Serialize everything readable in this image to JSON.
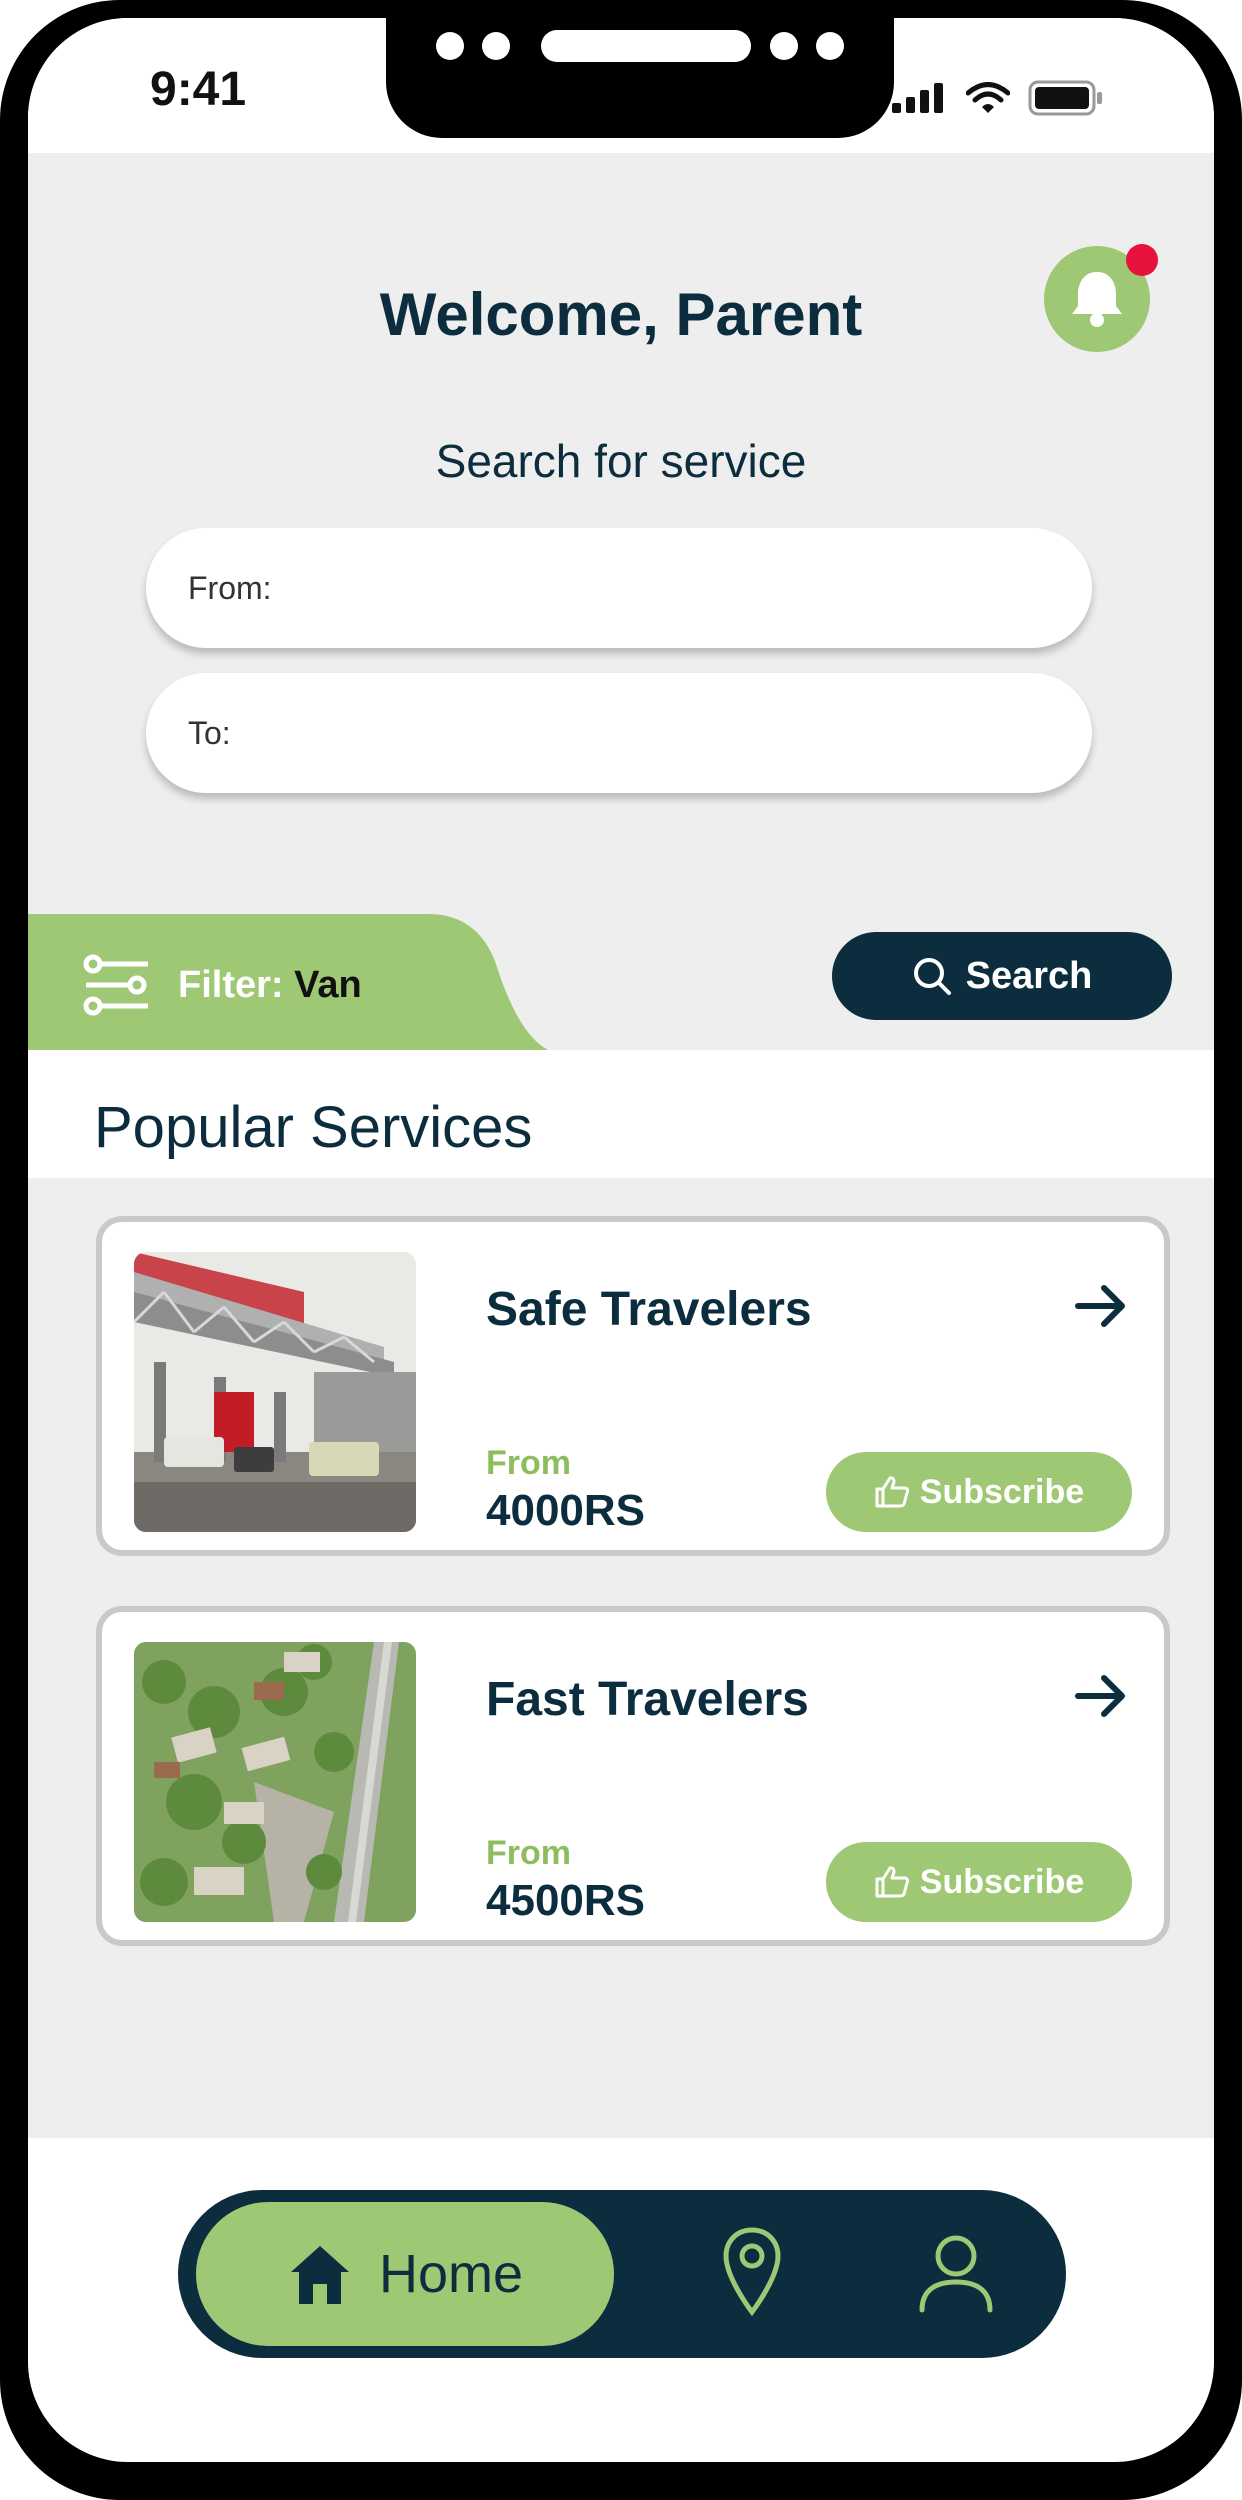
{
  "status": {
    "time": "9:41"
  },
  "header": {
    "welcome": "Welcome, Parent"
  },
  "search": {
    "title": "Search for service",
    "from_label": "From:",
    "to_label": "To:",
    "from_value": "",
    "to_value": "",
    "button_label": "Search"
  },
  "filter": {
    "label": "Filter:",
    "value": "Van"
  },
  "popular": {
    "title": "Popular Services",
    "services": [
      {
        "name": "Safe Travelers",
        "from_label": "From",
        "price": "4000RS",
        "subscribe_label": "Subscribe",
        "image": "elevated-bus-station-photo"
      },
      {
        "name": "Fast Travelers",
        "from_label": "From",
        "price": "4500RS",
        "subscribe_label": "Subscribe",
        "image": "aerial-city-road-photo"
      }
    ]
  },
  "nav": {
    "home_label": "Home",
    "items": [
      "home-icon",
      "location-pin-icon",
      "profile-icon"
    ]
  },
  "colors": {
    "navy": "#0c2d3e",
    "green": "#9fc875",
    "badge_red": "#e8123f",
    "background": "#eeeeee"
  }
}
